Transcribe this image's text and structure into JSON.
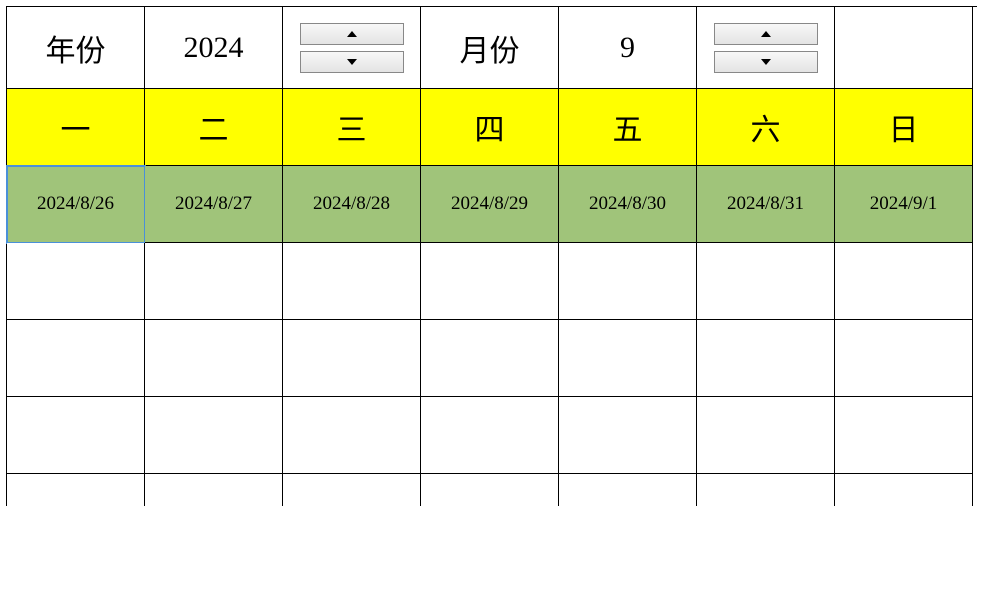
{
  "controls": {
    "year_label": "年份",
    "year_value": "2024",
    "month_label": "月份",
    "month_value": "9"
  },
  "weekdays": [
    "一",
    "二",
    "三",
    "四",
    "五",
    "六",
    "日"
  ],
  "dates_row1": [
    "2024/8/26",
    "2024/8/27",
    "2024/8/28",
    "2024/8/29",
    "2024/8/30",
    "2024/8/31",
    "2024/9/1"
  ]
}
